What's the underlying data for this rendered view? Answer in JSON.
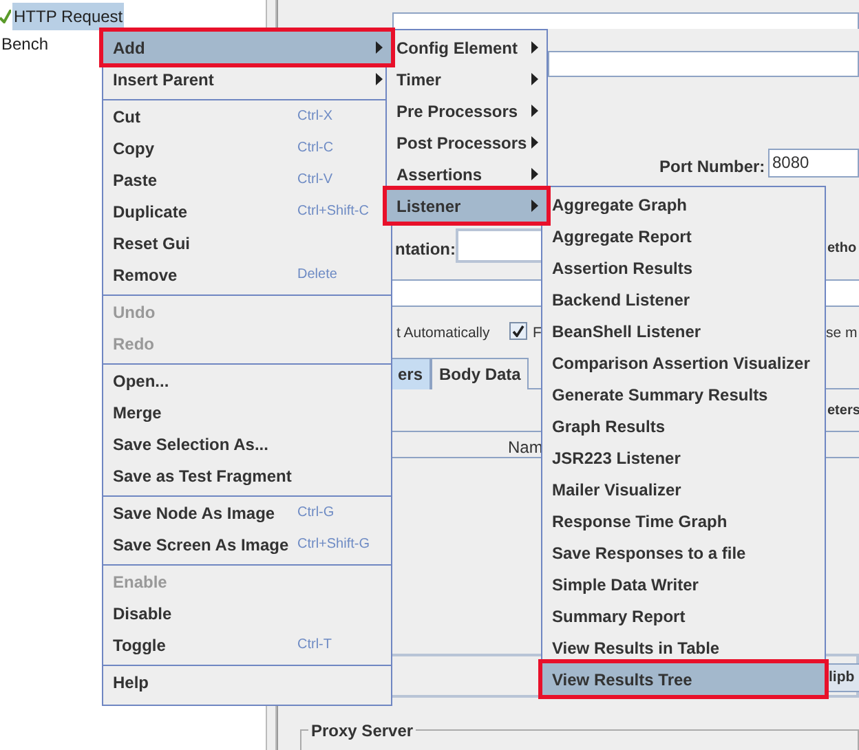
{
  "tree": [
    {
      "label": "HTTP Request",
      "selected": true
    },
    {
      "label": "Bench",
      "selected": false
    }
  ],
  "form": {
    "port_label": "Port Number:",
    "port_value": "8080",
    "implementation_label": "ntation:",
    "method_label": "etho",
    "follow_label": "t Automatically",
    "follow_checked": true,
    "follow_redirects_label": "F",
    "multipart_label": "se m",
    "tabs": [
      {
        "label": "ers",
        "selected": true
      },
      {
        "label": "Body Data",
        "selected": false
      }
    ],
    "parameters_label": "eters",
    "column_header": "Nam",
    "clipboard_button": "lipb",
    "proxy_group": "Proxy Server"
  },
  "context_menu": {
    "items": [
      {
        "kind": "item",
        "label": "Add",
        "has_submenu": true,
        "disabled": false,
        "selected": true
      },
      {
        "kind": "item",
        "label": "Insert Parent",
        "has_submenu": true,
        "disabled": false,
        "selected": false
      },
      {
        "kind": "separator"
      },
      {
        "kind": "item",
        "label": "Cut",
        "shortcut": "Ctrl-X",
        "has_submenu": false,
        "disabled": false,
        "selected": false
      },
      {
        "kind": "item",
        "label": "Copy",
        "shortcut": "Ctrl-C",
        "has_submenu": false,
        "disabled": false,
        "selected": false
      },
      {
        "kind": "item",
        "label": "Paste",
        "shortcut": "Ctrl-V",
        "has_submenu": false,
        "disabled": false,
        "selected": false
      },
      {
        "kind": "item",
        "label": "Duplicate",
        "shortcut": "Ctrl+Shift-C",
        "has_submenu": false,
        "disabled": false,
        "selected": false
      },
      {
        "kind": "item",
        "label": "Reset Gui",
        "has_submenu": false,
        "disabled": false,
        "selected": false
      },
      {
        "kind": "item",
        "label": "Remove",
        "shortcut": "Delete",
        "has_submenu": false,
        "disabled": false,
        "selected": false
      },
      {
        "kind": "separator"
      },
      {
        "kind": "item",
        "label": "Undo",
        "has_submenu": false,
        "disabled": true,
        "selected": false
      },
      {
        "kind": "item",
        "label": "Redo",
        "has_submenu": false,
        "disabled": true,
        "selected": false
      },
      {
        "kind": "separator"
      },
      {
        "kind": "item",
        "label": "Open...",
        "has_submenu": false,
        "disabled": false,
        "selected": false
      },
      {
        "kind": "item",
        "label": "Merge",
        "has_submenu": false,
        "disabled": false,
        "selected": false
      },
      {
        "kind": "item",
        "label": "Save Selection As...",
        "has_submenu": false,
        "disabled": false,
        "selected": false
      },
      {
        "kind": "item",
        "label": "Save as Test Fragment",
        "has_submenu": false,
        "disabled": false,
        "selected": false
      },
      {
        "kind": "separator"
      },
      {
        "kind": "item",
        "label": "Save Node As Image",
        "shortcut": "Ctrl-G",
        "has_submenu": false,
        "disabled": false,
        "selected": false
      },
      {
        "kind": "item",
        "label": "Save Screen As Image",
        "shortcut": "Ctrl+Shift-G",
        "has_submenu": false,
        "disabled": false,
        "selected": false
      },
      {
        "kind": "separator"
      },
      {
        "kind": "item",
        "label": "Enable",
        "has_submenu": false,
        "disabled": true,
        "selected": false
      },
      {
        "kind": "item",
        "label": "Disable",
        "has_submenu": false,
        "disabled": false,
        "selected": false
      },
      {
        "kind": "item",
        "label": "Toggle",
        "shortcut": "Ctrl-T",
        "has_submenu": false,
        "disabled": false,
        "selected": false
      },
      {
        "kind": "separator"
      },
      {
        "kind": "item",
        "label": "Help",
        "has_submenu": false,
        "disabled": false,
        "selected": false
      }
    ]
  },
  "add_submenu": {
    "items": [
      {
        "label": "Config Element",
        "has_submenu": true,
        "selected": false
      },
      {
        "label": "Timer",
        "has_submenu": true,
        "selected": false
      },
      {
        "label": "Pre Processors",
        "has_submenu": true,
        "selected": false
      },
      {
        "label": "Post Processors",
        "has_submenu": true,
        "selected": false
      },
      {
        "label": "Assertions",
        "has_submenu": true,
        "selected": false
      },
      {
        "label": "Listener",
        "has_submenu": true,
        "selected": true
      }
    ]
  },
  "listener_submenu": {
    "items": [
      {
        "label": "Aggregate Graph",
        "selected": false
      },
      {
        "label": "Aggregate Report",
        "selected": false
      },
      {
        "label": "Assertion Results",
        "selected": false
      },
      {
        "label": "Backend Listener",
        "selected": false
      },
      {
        "label": "BeanShell Listener",
        "selected": false
      },
      {
        "label": "Comparison Assertion Visualizer",
        "selected": false
      },
      {
        "label": "Generate Summary Results",
        "selected": false
      },
      {
        "label": "Graph Results",
        "selected": false
      },
      {
        "label": "JSR223 Listener",
        "selected": false
      },
      {
        "label": "Mailer Visualizer",
        "selected": false
      },
      {
        "label": "Response Time Graph",
        "selected": false
      },
      {
        "label": "Save Responses to a file",
        "selected": false
      },
      {
        "label": "Simple Data Writer",
        "selected": false
      },
      {
        "label": "Summary Report",
        "selected": false
      },
      {
        "label": "View Results in Table",
        "selected": false
      },
      {
        "label": "View Results Tree",
        "selected": true
      }
    ]
  }
}
